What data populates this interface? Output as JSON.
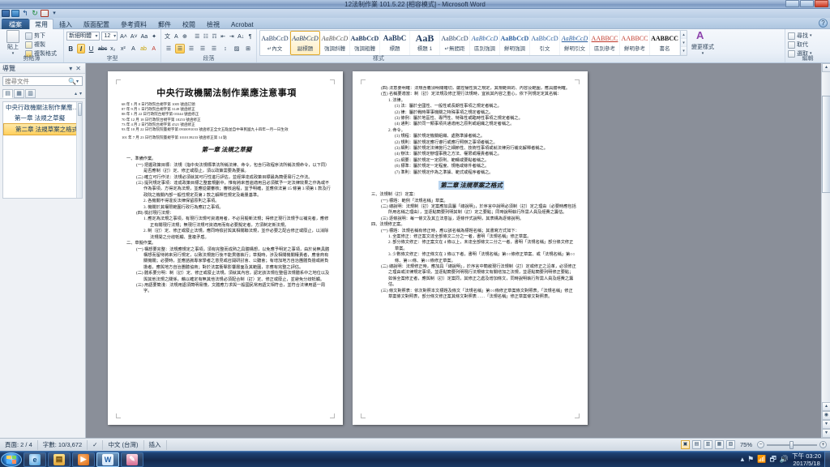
{
  "window": {
    "title": "12法制作業 101.5.22 [相容模式] - Microsoft Word",
    "minimize": "—",
    "maximize": "❐",
    "close": "✕"
  },
  "quick_access": {
    "items": [
      {
        "name": "word-logo-icon",
        "glyph": "W"
      },
      {
        "name": "save-icon",
        "glyph": "💾"
      },
      {
        "name": "undo-icon",
        "glyph": "↰"
      },
      {
        "name": "redo-icon",
        "glyph": "↻"
      },
      {
        "name": "pdf-icon",
        "glyph": "A"
      },
      {
        "name": "customize-qat-icon",
        "glyph": "▾"
      }
    ]
  },
  "tabs": [
    {
      "label": "檔案",
      "kind": "file"
    },
    {
      "label": "常用",
      "kind": "active"
    },
    {
      "label": "插入",
      "kind": "normal"
    },
    {
      "label": "版面配置",
      "kind": "normal"
    },
    {
      "label": "參考資料",
      "kind": "normal"
    },
    {
      "label": "郵件",
      "kind": "normal"
    },
    {
      "label": "校閱",
      "kind": "normal"
    },
    {
      "label": "檢視",
      "kind": "normal"
    },
    {
      "label": "Acrobat",
      "kind": "normal"
    }
  ],
  "help_button": "?",
  "ribbon": {
    "clipboard": {
      "label": "剪貼簿",
      "paste": "貼上",
      "paste_arrow": "▾",
      "cut": "剪下",
      "copy": "複製",
      "format_painter": "複製格式",
      "dialog_launcher": "◢"
    },
    "font": {
      "label": "字型",
      "font_name": "新細明體",
      "font_size": "12",
      "grow": "A˄",
      "shrink": "A˅",
      "change_case": "Aa",
      "clear_format": "✦",
      "bold": "B",
      "italic": "I",
      "underline": "U",
      "strikethrough": "abc",
      "subscript": "x₂",
      "superscript": "x²",
      "text_effects": "A",
      "highlight": "ab",
      "font_color": "A",
      "phonetic": "文",
      "char_border": "A",
      "enclose": "⊕",
      "dialog_launcher": "◢"
    },
    "paragraph": {
      "label": "段落",
      "bullets": "☰",
      "numbering": "☷",
      "multilevel": "☶",
      "decrease_indent": "⇤",
      "increase_indent": "⇥",
      "sort": "A↓",
      "show_marks": "¶",
      "align_left": "☰",
      "align_center": "☰",
      "align_right": "☰",
      "justify": "☰",
      "distribute": "☰",
      "line_spacing": "↕",
      "shading": "▨",
      "borders": "⊞",
      "dialog_launcher": "◢"
    },
    "styles": {
      "label": "樣式",
      "change_styles": "變更樣式",
      "dialog_launcher": "◢",
      "gallery": [
        {
          "sample": "AaBbCcD",
          "name": "↵內文",
          "selected": false
        },
        {
          "sample": "AaBbCcD",
          "name": "副標題",
          "selected": true
        },
        {
          "sample": "AaBbCcD",
          "name": "強調斜體",
          "selected": false
        },
        {
          "sample": "AaBbCcD",
          "name": "強調粗體",
          "selected": false
        },
        {
          "sample": "AaBbC",
          "name": "標題",
          "selected": false
        },
        {
          "sample": "AaB",
          "name": "標題 1",
          "selected": false
        },
        {
          "sample": "AaBbCcD",
          "name": "↵無間距",
          "selected": false
        },
        {
          "sample": "AaBbCcD",
          "name": "區別強調",
          "selected": false
        },
        {
          "sample": "AaBbCcD",
          "name": "鮮明強調",
          "selected": false
        },
        {
          "sample": "AaBbCcD",
          "name": "引文",
          "selected": false
        },
        {
          "sample": "AaBbCcD",
          "name": "鮮明引文",
          "selected": false
        },
        {
          "sample": "AABBCC",
          "name": "區別參考",
          "selected": false
        },
        {
          "sample": "AABBCC",
          "name": "鮮明參考",
          "selected": false
        },
        {
          "sample": "AABBCC",
          "name": "書名",
          "selected": false
        }
      ],
      "scroll_up": "▴",
      "scroll_down": "▾",
      "more": "▾"
    },
    "editing": {
      "label": "編輯",
      "find": "尋找",
      "find_arrow": "▾",
      "replace": "取代",
      "select": "選取",
      "select_arrow": "▾"
    }
  },
  "navigation": {
    "title": "導覽",
    "dropdown": "▾",
    "close": "✕",
    "search_placeholder": "搜尋文件",
    "search_value": "",
    "search_icon": "🔍",
    "search_dropdown": "▾",
    "tabs": [
      {
        "name": "browse-headings-tab",
        "glyph": "▤",
        "active": true
      },
      {
        "name": "browse-pages-tab",
        "glyph": "▦",
        "active": false
      },
      {
        "name": "browse-results-tab",
        "glyph": "▥",
        "active": false
      }
    ],
    "prev": "▴",
    "next": "▾",
    "headings": [
      {
        "label": "中央行政機關法制作業應…",
        "level": 1,
        "selected": false,
        "expander": "◢"
      },
      {
        "label": "第一章 法規之草擬",
        "level": 2,
        "selected": false
      },
      {
        "label": "第二章 法規草案之格式",
        "level": 2,
        "selected": true
      }
    ]
  },
  "document": {
    "title": "中央行政機關法制作業應注意事項",
    "amendments": [
      "68 年 1 月 8 日行政院台規字第 1005 號函訂頒",
      "87 年 9 月 1 日行政院台規字第 3149 號函修正",
      "88 年 1 月 22 日行政院台規字第 03344 號函修正",
      "70 年 12 月 18 日行政院台規字第 18253 號函修正",
      "73 年 4 月 2 日行政院台規字第 4521 號函修正",
      "93 年 10 月 22 日行政院院臺規字第 0930091033 號函修正全文五點並自中華民國九十四年一月一日生效",
      "101 年 7 月 23 日行政院院臺規字第 1010139233 號函修正第 14 點"
    ],
    "page_left": {
      "chapter": "第一章  法規之草擬",
      "sections": [
        {
          "style": "p0",
          "text": "一、準備作業。"
        },
        {
          "style": "p1",
          "text": "(一) 把握政策目標：法規（指中央法規標準法所稱法律、命令，包含行政程序法所稱法規命令，以下同）是否應制（訂）定、修正或廢止，須以政策需要為要據。"
        },
        {
          "style": "p1",
          "text": "(二) 確立可行作法：法規必須就其可行性進行評估，並經擇達成政策目標最為簡便易行之作法。"
        },
        {
          "style": "p1",
          "text": "(三) 提列規定事項：達成政策目標之整套規劃中，惟有將來普遍適用且必須賦予一定法律效果之作為或不作為事項，方得定為法規，並應從嚴審核；審核過程，宜予明確，並應依法第 15 條第 3 項第 1 款及行政院之機關內部一般性規定頁第 2 款之解釋性規定及裁量基準。"
        },
        {
          "style": "p2",
          "text": "2. 各機關不得違反法律保留原則之事項。"
        },
        {
          "style": "p2",
          "text": "3. 機關於其權限範圍行政行為應訂之事項。"
        },
        {
          "style": "p1",
          "text": "(四) 檢討現行法規："
        },
        {
          "style": "p2",
          "text": "1. 應定為法規之事項，有現行法規可資適用者，不必另擬新法規；得修正現行法規予以補充者，應修正有關現行法規；無現行法規可資適用而有必要擬定者，方須制定新法規。"
        },
        {
          "style": "p2",
          "text": "2. 制（訂）定、修正或廢止法規，應同時檢討與其相關聯法規，並作必要之配合修正或廢止，以消除法規間之分歧牴觸、重複矛盾。"
        },
        {
          "style": "p0",
          "text": "二、草擬作業。"
        },
        {
          "style": "p1",
          "text": "(一) 構想要完整：法規應規定之事項，須有完整而成熟之具體構想，以免應予明定之事項，由於尚無具體構想而留待將來另行規定，以致法規施行後不能貫徹執行；草擬時，涉及相關機關權責者，應會商有關機關；必要時，並應諮詢專家學者之意見或召開研討會、公聽會；有增加地方自治團體負擔或將負擔者，應與地方自治團體協商；對於法案衝擊影響層面及其範圍，亦應有完整之評估。"
        },
        {
          "style": "p1",
          "text": "(二) 體系要分明：制（訂）定、修正或廢止法規，須就其內容，認定該法規在整個法規體系中之地位以及與其他法規之關係，藉以確定有無其他法規必須配合制（訂）定、修正或廢止，並避免分歧牴觸。"
        },
        {
          "style": "p1",
          "text": "(三) 用語要簡淺：法規用語須簡明易懂，文體應力求與一般國民常用語文相符合，並符合法律用語一周字。"
        }
      ]
    },
    "page_right": {
      "chapter": "第二章  法規草案之格式",
      "chapter_highlighted": true,
      "sections": [
        {
          "style": "p1",
          "text": "(四) 法意要明確：法規含義須明關確切，嚴控權性質之規定，其規範目的、內容及範圍，應具體明確。"
        },
        {
          "style": "p1",
          "text": "(五) 名稱要適當：制（訂）定法規及修正現行法規時，宜就其內容之重心，依下列規定定其名稱："
        },
        {
          "style": "p2",
          "text": "1. 法律。"
        },
        {
          "style": "p3",
          "text": "(1) 法：屬於全國性、一般性或長期性事項之規定者稱之。"
        },
        {
          "style": "p3",
          "text": "(2) 律：屬於戰時軍事機關之特殊事項之規定者稱之。"
        },
        {
          "style": "p3",
          "text": "(3) 條例：屬於地區性、專門性、特殊性或臨時性事項之規定者稱之。"
        },
        {
          "style": "p3",
          "text": "(4) 通則：屬於同一類事項共通適用之原則或組織之規定者稱之。"
        },
        {
          "style": "p2",
          "text": "2. 命令。"
        },
        {
          "style": "p3",
          "text": "(1) 規程：屬於規定機關組織、處務準據者稱之。"
        },
        {
          "style": "p3",
          "text": "(2) 規則：屬於規定應行遵行或應行照辦之事項者稱之。"
        },
        {
          "style": "p3",
          "text": "(3) 細則：屬於規定法律施行之細節性、技術性事項或就法律另行補充解釋者稱之。"
        },
        {
          "style": "p3",
          "text": "(4) 辦法：屬於規定辦理事務之方法、權限或權責者稱之。"
        },
        {
          "style": "p3",
          "text": "(5) 綱要：屬於規定一定原則、範疇或要點者稱之。"
        },
        {
          "style": "p3",
          "text": "(6) 標準：屬於規定一定程度、規格或條件者稱之。"
        },
        {
          "style": "p3",
          "text": "(7) 準則：屬於規定作為之準據、範式或程序者稱之。"
        },
        {
          "style": "p0",
          "text": "三、法規制（訂）定案："
        },
        {
          "style": "p1",
          "text": "(一) 標題：範例「法規名稱」草案。"
        },
        {
          "style": "p1",
          "text": "(二) 總說明：法規制（訂）定案應加具屬「總說明」，於序言中說明必須制（訂）定之理由（必要時應包括所用名稱之理由），並逐點簡要列明其制（訂）定之要點；同時說明執行所需人員及經費之籌估。"
        },
        {
          "style": "p1",
          "text": "(三) 逐條說明：每一條文及其立法意旨，逐條作式說明，其表構為逐條說明。"
        },
        {
          "style": "p0",
          "text": "四、法規修正案。"
        },
        {
          "style": "p1",
          "text": "(一) 標題：法規名稱有修正時，應以該名稱為標題名稱；其書寫方式如下："
        },
        {
          "style": "p2",
          "text": "1. 全案修正：修正案文達全部條文二分之一者，書明「法規名稱」修正草案。"
        },
        {
          "style": "p2",
          "text": "2. 部分條文修正：修正案文在 4 條以上，未達全部條文二分之一者，書明「法規名稱」部分條文修正草案。"
        },
        {
          "style": "p2",
          "text": "3. 少數條文修正：修正條文在 3 條以下者，書明「法規名稱」第○○條修正草案、或「法規名稱」第○○條、第○○條、第○○條修正草案。"
        },
        {
          "style": "p1",
          "text": "(二) 總說明：法規修正時，應加具「總說明」，於序言中簡敘現行法規制（訂）定或修正之沿革，必須修正之理由或法律規定事項，並逐點簡要列明現行法規條文有關增加之法規，並逐點簡要列明修正要點；如係全案修正者，應與制（訂）定案同，其修正之處及增加條文，同時說明執行所需人員及經費之籌估。"
        },
        {
          "style": "p1",
          "text": "(三) 條文對照表：依次對照本文標題及條文「法規名稱」第○○條修正草案條文對照表。「法規名稱」修正草案條文對照表，部分條文修正案其條文對照表……「法規名稱」修正草案條文對照表。"
        }
      ]
    }
  },
  "status_bar": {
    "page": "頁面: 2 / 4",
    "words": "字數: 10/3,672",
    "proofing_icon": "✓",
    "language": "中文 (台灣)",
    "insert_mode": "插入",
    "views": [
      {
        "name": "print-layout-view",
        "glyph": "▣",
        "active": true
      },
      {
        "name": "full-screen-reading-view",
        "glyph": "▤",
        "active": false
      },
      {
        "name": "web-layout-view",
        "glyph": "▥",
        "active": false
      },
      {
        "name": "outline-view",
        "glyph": "▦",
        "active": false
      },
      {
        "name": "draft-view",
        "glyph": "▧",
        "active": false
      }
    ],
    "zoom": "75%",
    "zoom_out": "−",
    "zoom_in": "+"
  },
  "taskbar": {
    "start": "⊞",
    "apps": [
      {
        "name": "internet-explorer",
        "glyph": "e",
        "cls": "ie",
        "active": false
      },
      {
        "name": "windows-explorer",
        "glyph": "▤",
        "cls": "ex",
        "active": false
      },
      {
        "name": "media-player",
        "glyph": "▶",
        "cls": "wmp",
        "active": false
      },
      {
        "name": "microsoft-word",
        "glyph": "W",
        "cls": "w",
        "active": true
      },
      {
        "name": "paint",
        "glyph": "✎",
        "cls": "paint",
        "active": false
      }
    ],
    "tray": [
      {
        "name": "show-hidden-icons",
        "glyph": "▴"
      },
      {
        "name": "action-center-icon",
        "glyph": "⚑"
      },
      {
        "name": "network-icon",
        "glyph": "📶"
      },
      {
        "name": "removable-media-icon",
        "glyph": "🗗"
      },
      {
        "name": "volume-icon",
        "glyph": "🔊"
      }
    ],
    "clock_time": "下午 03:20",
    "clock_date": "2017/5/18"
  }
}
